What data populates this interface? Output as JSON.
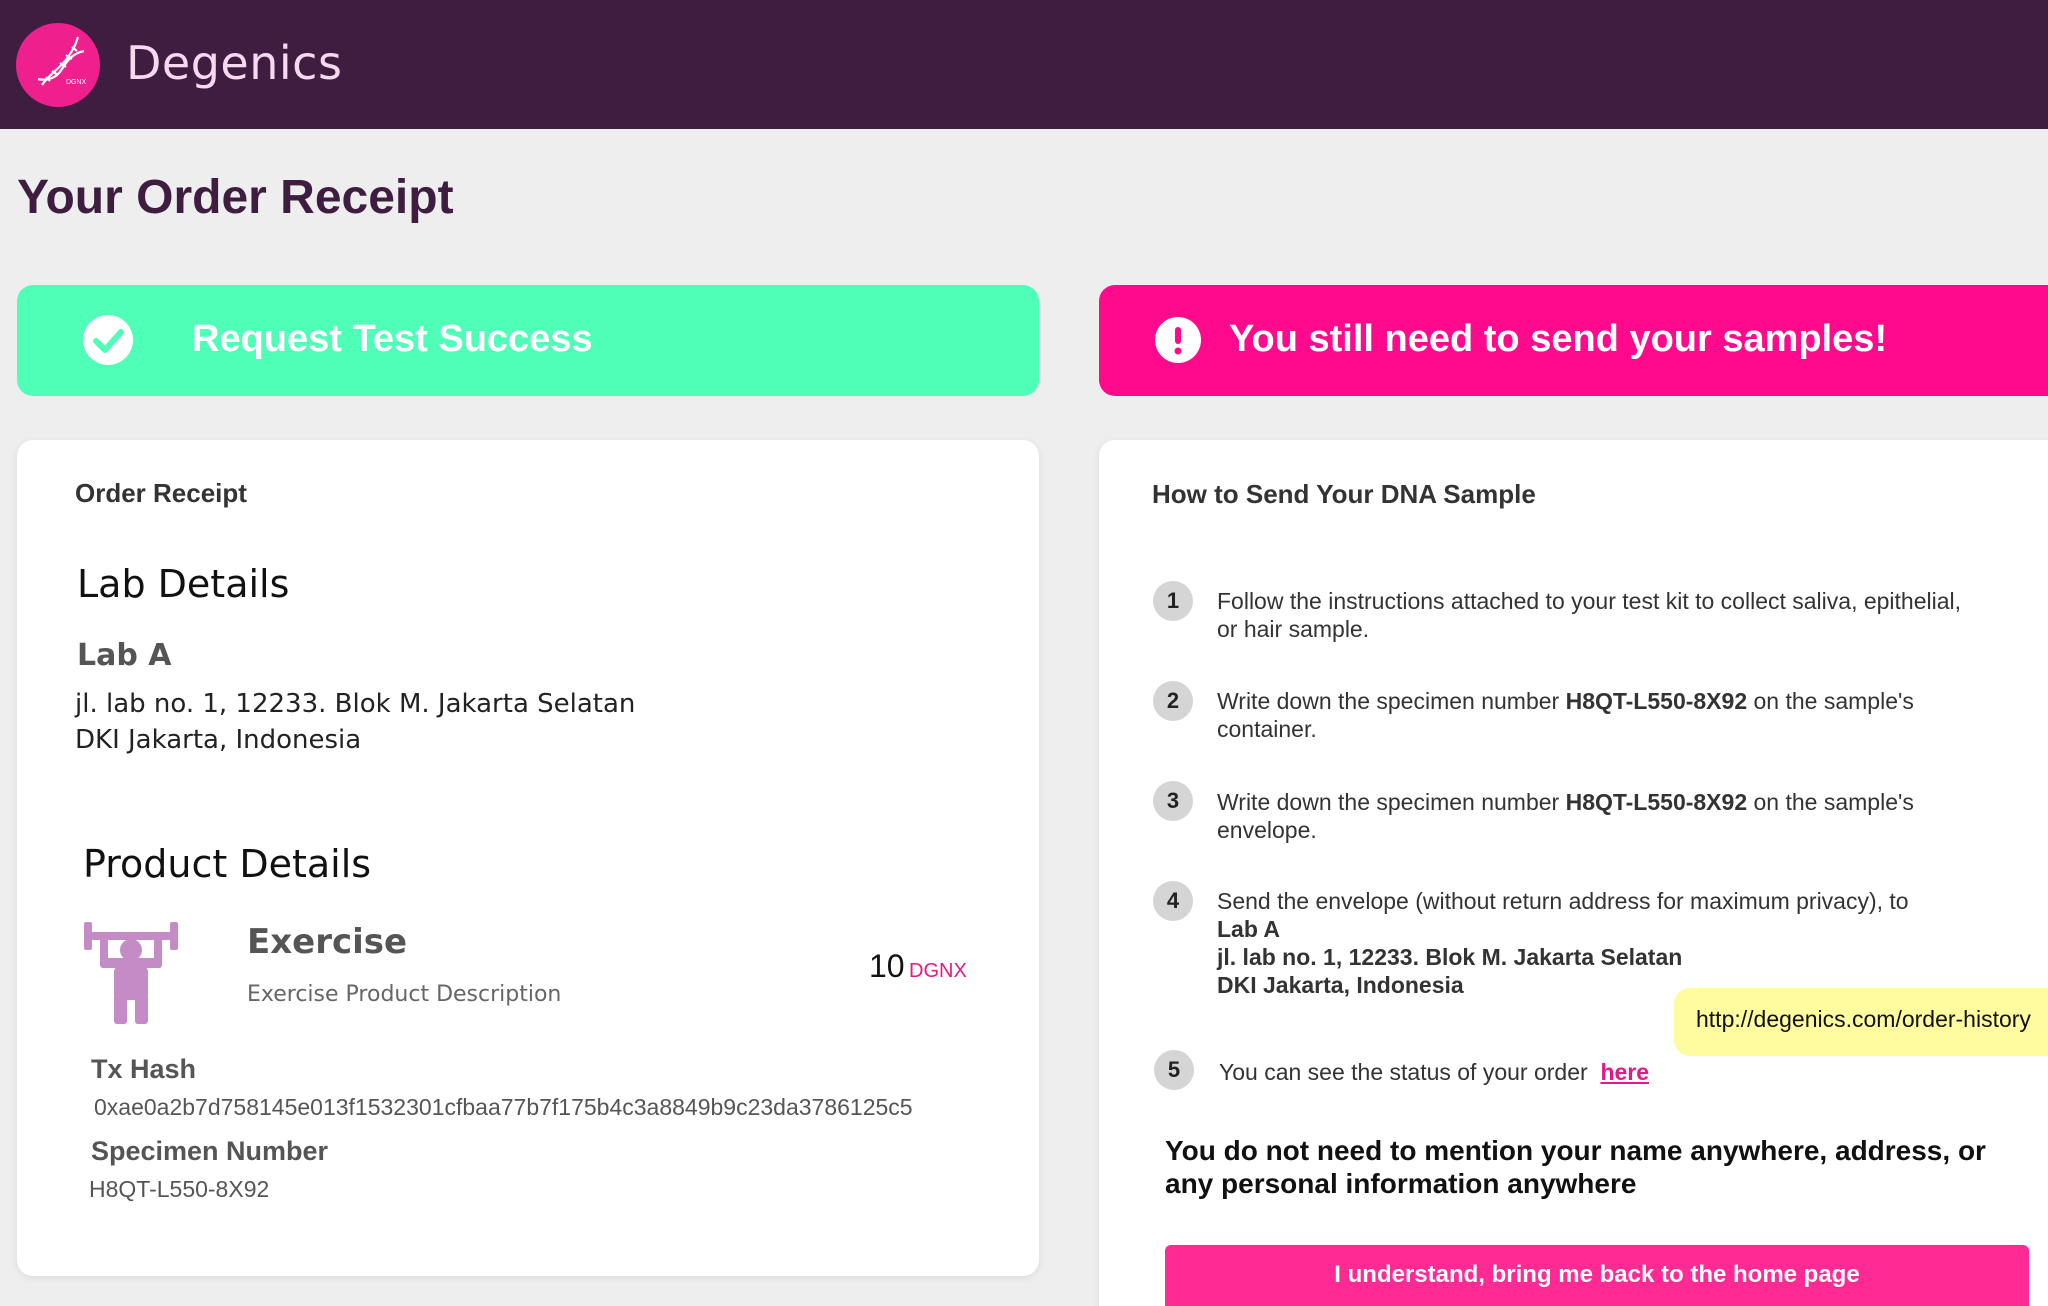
{
  "header": {
    "brand": "Degenics",
    "logo_text": "DGNX",
    "background": "#3e1d41",
    "logo_color": "#f01f8e"
  },
  "page": {
    "title": "Your Order Receipt"
  },
  "banners": {
    "success": {
      "text": "Request Test Success",
      "icon": "check-circle-icon",
      "color": "#4fffb7"
    },
    "warning": {
      "text": "You still need to send your samples!",
      "icon": "exclamation-circle-icon",
      "color": "#ff0a8c"
    }
  },
  "receipt": {
    "card_title": "Order Receipt",
    "lab_heading": "Lab Details",
    "lab_name": "Lab A",
    "lab_address_line1": "jl. lab no. 1, 12233. Blok M. Jakarta Selatan",
    "lab_address_line2": "DKI Jakarta, Indonesia",
    "product_heading": "Product Details",
    "product_icon": "weightlifting-icon",
    "product_name": "Exercise",
    "product_description": "Exercise Product Description",
    "price_value": "10",
    "price_unit": "DGNX",
    "tx_hash_label": "Tx Hash",
    "tx_hash_value": "0xae0a2b7d758145e013f1532301cfbaa77b7f175b4c3a8849b9c23da3786125c5",
    "specimen_label": "Specimen Number",
    "specimen_value": "H8QT-L550-8X92"
  },
  "instructions": {
    "card_title": "How to Send Your DNA Sample",
    "steps": [
      {
        "number": "1",
        "line1": "Follow the instructions attached to your test kit to collect saliva, epithelial,",
        "line2": "or hair sample."
      },
      {
        "number": "2",
        "pre": "Write down the specimen number ",
        "specimen": "H8QT-L550-8X92",
        "post": " on the sample's",
        "line2": "container."
      },
      {
        "number": "3",
        "pre": "Write down the specimen number ",
        "specimen": "H8QT-L550-8X92",
        "post": " on the sample's",
        "line2": "envelope."
      },
      {
        "number": "4",
        "line1": "Send the envelope (without return address for maximum privacy), to",
        "lab_name": "Lab A",
        "address_line1": "jl. lab no. 1, 12233. Blok M. Jakarta Selatan",
        "address_line2": "DKI Jakarta, Indonesia"
      },
      {
        "number": "5",
        "text": "You can see the status of your order",
        "link": "here"
      }
    ],
    "tooltip_url": "http://degenics.com/order-history",
    "privacy_note": "You do not need to mention your name anywhere, address, or any personal information anywhere",
    "home_button": "I understand, bring me back to the home page"
  }
}
